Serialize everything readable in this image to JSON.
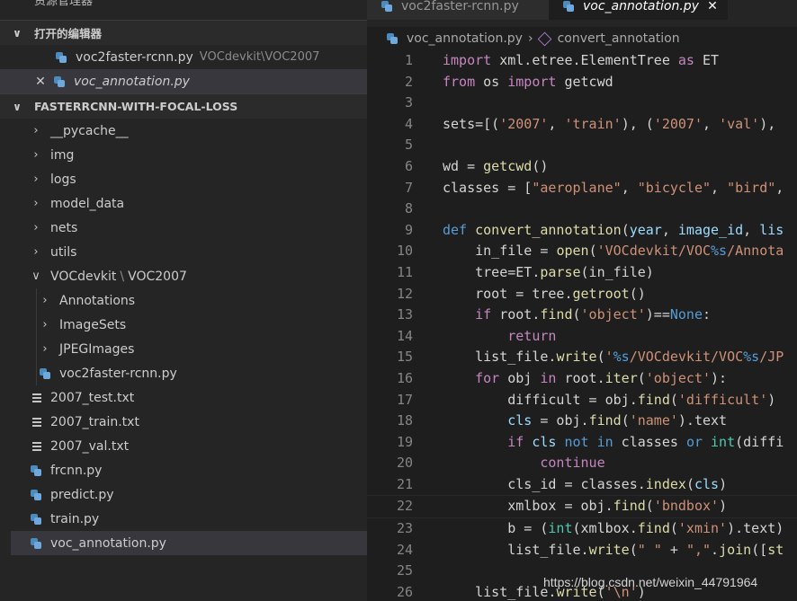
{
  "explorer": {
    "title": "资源管理器",
    "open_editors": {
      "label": "打开的编辑器",
      "items": [
        {
          "name": "voc2faster-rcnn.py",
          "desc": "VOCdevkit\\VOC2007"
        },
        {
          "name": "voc_annotation.py"
        }
      ]
    },
    "project": {
      "label": "FASTERRCNN-WITH-FOCAL-LOSS",
      "items": [
        {
          "name": "__pycache__"
        },
        {
          "name": "img"
        },
        {
          "name": "logs"
        },
        {
          "name": "model_data"
        },
        {
          "name": "nets"
        },
        {
          "name": "utils"
        },
        {
          "name": "VOCdevkit",
          "name2": "VOC2007",
          "sep": "\\"
        },
        {
          "name": "Annotations"
        },
        {
          "name": "ImageSets"
        },
        {
          "name": "JPEGImages"
        },
        {
          "name": "voc2faster-rcnn.py"
        },
        {
          "name": "2007_test.txt"
        },
        {
          "name": "2007_train.txt"
        },
        {
          "name": "2007_val.txt"
        },
        {
          "name": "frcnn.py"
        },
        {
          "name": "predict.py"
        },
        {
          "name": "train.py"
        },
        {
          "name": "voc_annotation.py"
        }
      ]
    }
  },
  "tabs": [
    {
      "label": "voc2faster-rcnn.py"
    },
    {
      "label": "voc_annotation.py"
    }
  ],
  "breadcrumb": {
    "file": "voc_annotation.py",
    "symbol": "convert_annotation"
  },
  "code": {
    "lines": [
      "1",
      "2",
      "3",
      "4",
      "5",
      "6",
      "7",
      "8",
      "9",
      "10",
      "11",
      "12",
      "13",
      "14",
      "15",
      "16",
      "17",
      "18",
      "19",
      "20",
      "21",
      "22",
      "23",
      "24",
      "25",
      "26"
    ]
  },
  "watermark": "https://blog.csdn.net/weixin_44791964",
  "colors": {
    "accent_python": "#4b8bbe",
    "keyword": "#c586c0",
    "string": "#ce9178",
    "function": "#dcdcaa"
  }
}
